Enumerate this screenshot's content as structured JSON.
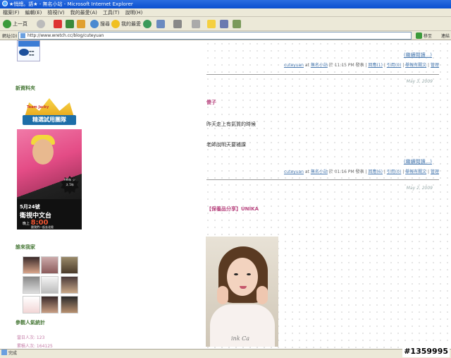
{
  "window": {
    "title": "★悄總。語★ - 無名小站 - Microsoft Internet Explorer"
  },
  "menu": [
    "檔案(F)",
    "編輯(E)",
    "檢視(V)",
    "我的最愛(A)",
    "工具(T)",
    "說明(H)"
  ],
  "toolbar": {
    "back_label": "上一頁",
    "search_label": "搜尋",
    "favorites_label": "我的最愛"
  },
  "address": {
    "label": "網址(D)",
    "url": "http://www.wretch.cc/blog/cuteyuan",
    "go_label": "移至",
    "links_label": "連結"
  },
  "sidebar": {
    "new_info_heading": "新資料夾",
    "banner": {
      "ribbon_top": "Team Jacky",
      "ribbon": "精選試用團隊",
      "badge": "1999年 ジャス 5年",
      "line1": "5月24號",
      "line2": "衛視中文台",
      "line3_prefix": "晚上",
      "line3_time": "8:00",
      "line4": "跟我們一起去北極"
    },
    "friends_heading": "誰來我家",
    "stats_heading": "參觀人氣統計",
    "stats_today": "當日人次: 123",
    "stats_total": "累積人次: 164125"
  },
  "posts": [
    {
      "read_more": "(繼續閱讀...)",
      "meta": {
        "author": "cuteyuan",
        "at": "at",
        "site": "無名小站",
        "time": "於 11:15 PM 發表",
        "reply": "回應(1)",
        "trackback": "引用(0)",
        "report": "舉報有關文",
        "edit": "管理"
      }
    },
    {
      "date": "May 3, 2009",
      "title": "傻子",
      "body": [
        "昨天走上有氣質的時候",
        "老師說明天要補課"
      ],
      "read_more": "(繼續閱讀...)",
      "meta": {
        "author": "cuteyuan",
        "at": "at",
        "site": "無名小站",
        "time": "於 01:16 PM 發表",
        "reply": "回應(6)",
        "trackback": "引用(0)",
        "report": "舉報有關文",
        "edit": "管理"
      }
    },
    {
      "date": "May 2, 2009",
      "title": "【保養品分享】UNIKA",
      "photo_text": "ink Ca"
    }
  ],
  "status": {
    "text": "完成"
  },
  "watermark": "#1359995"
}
